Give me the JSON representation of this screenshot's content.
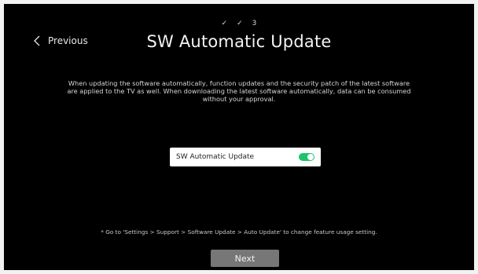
{
  "stepper": {
    "step1": "✓",
    "step2": "✓",
    "step3": "3"
  },
  "nav": {
    "previous_label": "Previous",
    "previous_icon": "chevron-left-icon"
  },
  "page": {
    "title": "SW Automatic Update",
    "description": "When updating the software automatically, function updates and the security patch of the latest software are applied to the TV as well. When downloading the latest software automatically, data can be consumed without your approval."
  },
  "setting": {
    "label": "SW Automatic Update",
    "enabled": true,
    "toggle_color": "#1bc468"
  },
  "footer": {
    "note": "* Go to 'Settings > Support > Software Update > Auto Update' to change feature usage setting.",
    "next_label": "Next"
  }
}
